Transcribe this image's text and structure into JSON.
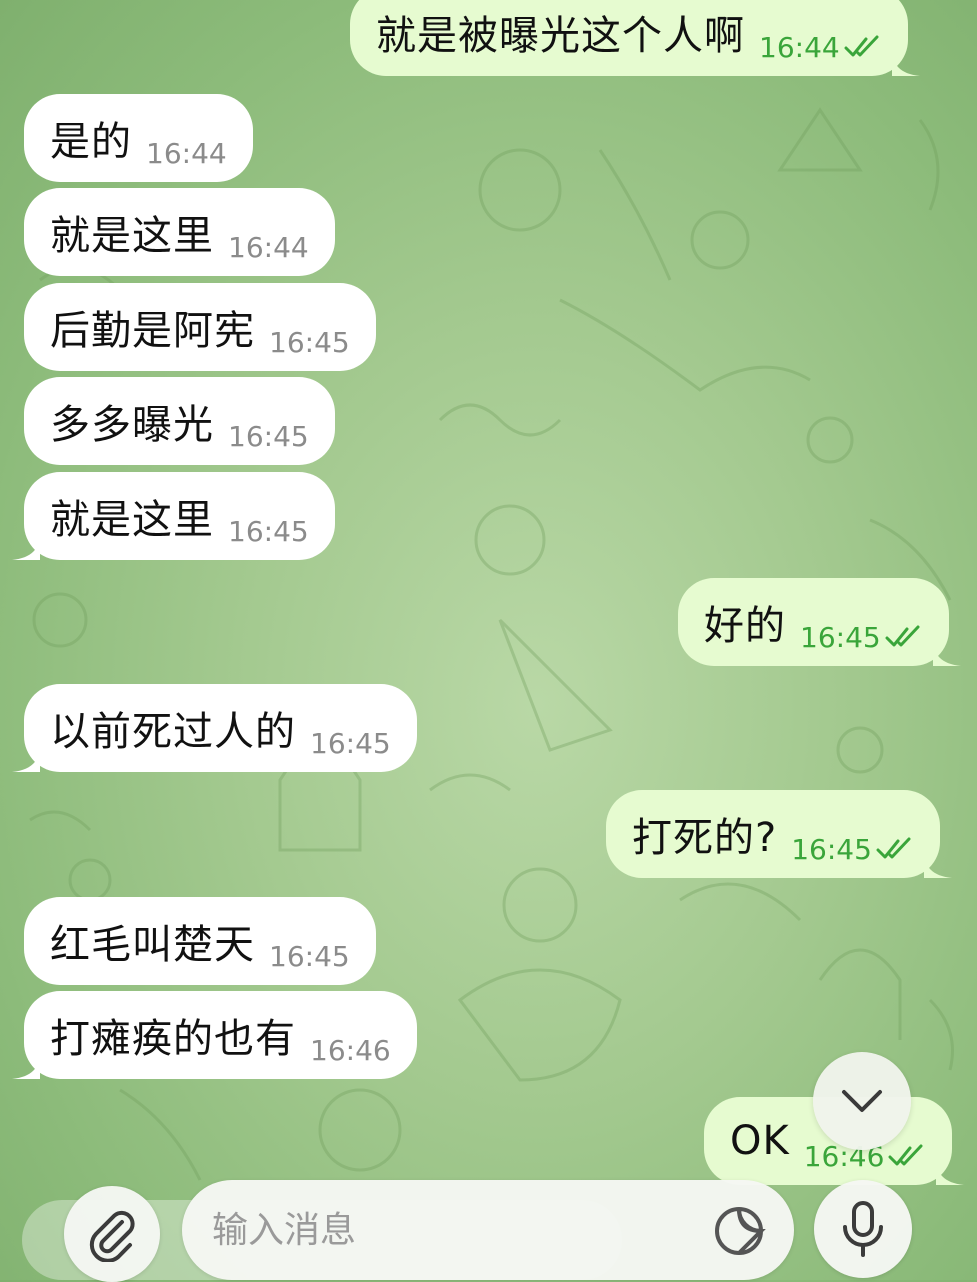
{
  "chat": {
    "messages": [
      {
        "direction": "out",
        "text": "就是被曝光这个人啊",
        "time": "16:44"
      },
      {
        "direction": "in",
        "text": "是的",
        "time": "16:44"
      },
      {
        "direction": "in",
        "text": "就是这里",
        "time": "16:44"
      },
      {
        "direction": "in",
        "text": "后勤是阿宪",
        "time": "16:45"
      },
      {
        "direction": "in",
        "text": "多多曝光",
        "time": "16:45"
      },
      {
        "direction": "in",
        "text": "就是这里",
        "time": "16:45"
      },
      {
        "direction": "out",
        "text": "好的",
        "time": "16:45"
      },
      {
        "direction": "in",
        "text": "以前死过人的",
        "time": "16:45"
      },
      {
        "direction": "out",
        "text": "打死的?",
        "time": "16:45"
      },
      {
        "direction": "in",
        "text": "红毛叫楚天",
        "time": "16:45"
      },
      {
        "direction": "in",
        "text": "打瘫痪的也有",
        "time": "16:46"
      },
      {
        "direction": "out",
        "text": "OK",
        "time": "16:46"
      }
    ]
  },
  "composer": {
    "placeholder": "输入消息"
  },
  "icons": {
    "read_receipt": "double-check-icon",
    "scroll_down": "chevron-down-icon",
    "attach": "paperclip-icon",
    "sticker": "sticker-icon",
    "voice": "microphone-icon"
  },
  "colors": {
    "incoming_bubble": "#ffffff",
    "outgoing_bubble": "#e6fbd0",
    "outgoing_time": "#3aa53a",
    "background": "#a3c98f"
  }
}
